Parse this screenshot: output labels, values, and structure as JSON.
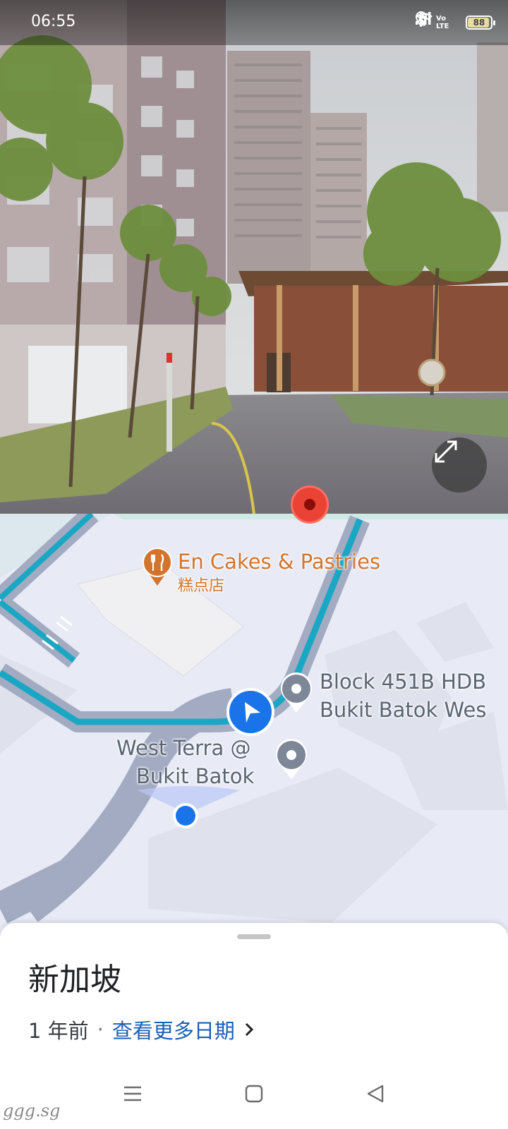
{
  "status_bar": {
    "time": "06:55",
    "battery_level": 88,
    "battery_text": "88",
    "network_label": "Vo LTE",
    "icons": [
      "bluetooth-icon",
      "location-icon",
      "wifi-icon",
      "volte-icon",
      "signal-icon",
      "battery-icon"
    ]
  },
  "street_view": {
    "expand_icon": "expand-diagonal-icon",
    "marker_color": "#ea4335"
  },
  "map": {
    "route_color": "#1aa7c4",
    "location_color": "#1a73e8",
    "pois": [
      {
        "name": "En Cakes & Pastries",
        "category": "糕点店",
        "icon": "restaurant-icon",
        "color": "#d3742c"
      },
      {
        "name_lines": [
          "Block 451B HDB",
          "Bukit Batok Wes"
        ],
        "icon": "place-pin-icon"
      },
      {
        "name_lines": [
          "West Terra @",
          "Bukit Batok"
        ],
        "icon": "place-pin-icon"
      }
    ],
    "navigation_arrow_icon": "navigation-arrow-icon"
  },
  "sheet": {
    "title": "新加坡",
    "date_age": "1 年前",
    "separator": "·",
    "more_dates": "查看更多日期",
    "more_dates_icon": "chevron-right-icon"
  },
  "nav_bar": {
    "icons": [
      "menu-icon",
      "home-square-icon",
      "back-triangle-icon"
    ]
  },
  "watermark": "ggg.sg"
}
